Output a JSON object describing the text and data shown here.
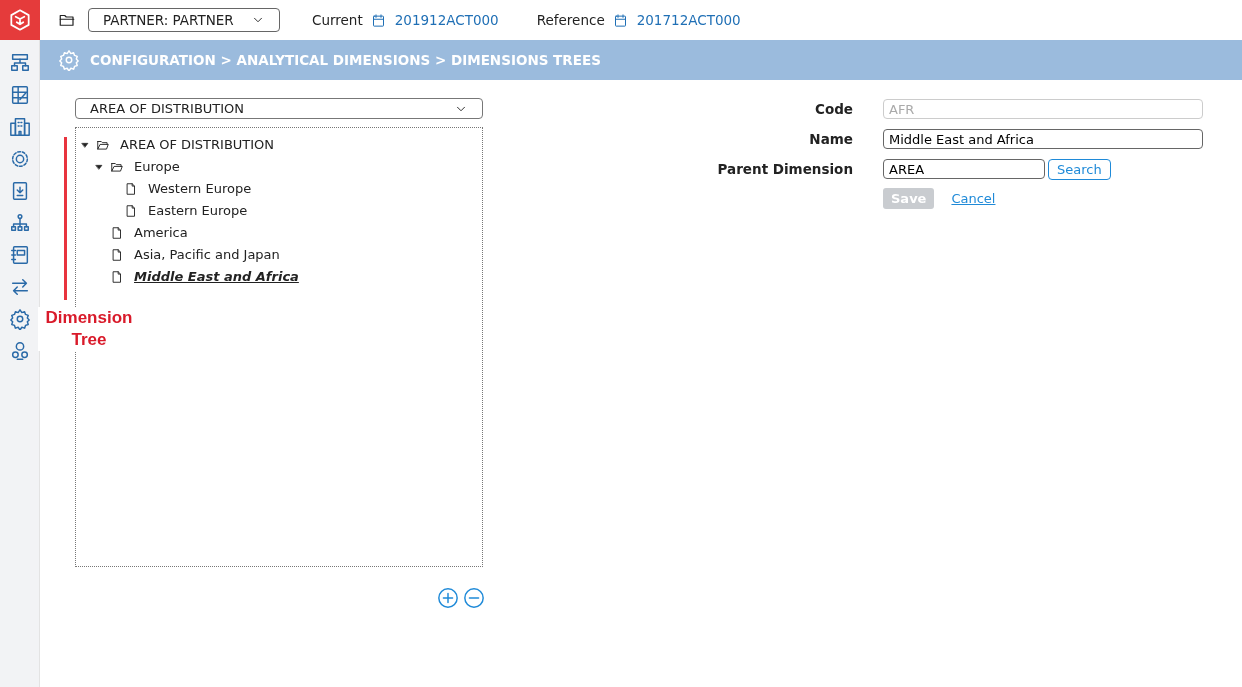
{
  "header": {
    "partner_select": "PARTNER: PARTNER",
    "current_label": "Current",
    "current_value": "201912ACT000",
    "reference_label": "Reference",
    "reference_value": "201712ACT000"
  },
  "breadcrumb": "CONFIGURATION > ANALYTICAL DIMENSIONS > DIMENSIONS TREES",
  "tree_select": "AREA OF DISTRIBUTION",
  "tree": [
    {
      "label": "AREA OF DISTRIBUTION",
      "kind": "folder",
      "expanded": true,
      "selected": false,
      "children": [
        {
          "label": "Europe",
          "kind": "folder",
          "expanded": true,
          "selected": false,
          "children": [
            {
              "label": "Western Europe",
              "kind": "leaf",
              "selected": false
            },
            {
              "label": "Eastern Europe",
              "kind": "leaf",
              "selected": false
            }
          ]
        },
        {
          "label": "America",
          "kind": "leaf",
          "selected": false
        },
        {
          "label": "Asia, Pacific and Japan",
          "kind": "leaf",
          "selected": false
        },
        {
          "label": "Middle East and Africa",
          "kind": "leaf",
          "selected": true
        }
      ]
    }
  ],
  "form": {
    "fields": [
      {
        "label": "Code",
        "value": "AFR",
        "disabled": true
      },
      {
        "label": "Name",
        "value": "Middle East and Africa",
        "disabled": false
      },
      {
        "label": "Parent Dimension",
        "value": "AREA",
        "disabled": false,
        "button": "Search"
      }
    ],
    "save": {
      "label": "Save",
      "disabled": true
    },
    "cancel": "Cancel"
  },
  "annotation": {
    "text": "Dimension Tree"
  }
}
